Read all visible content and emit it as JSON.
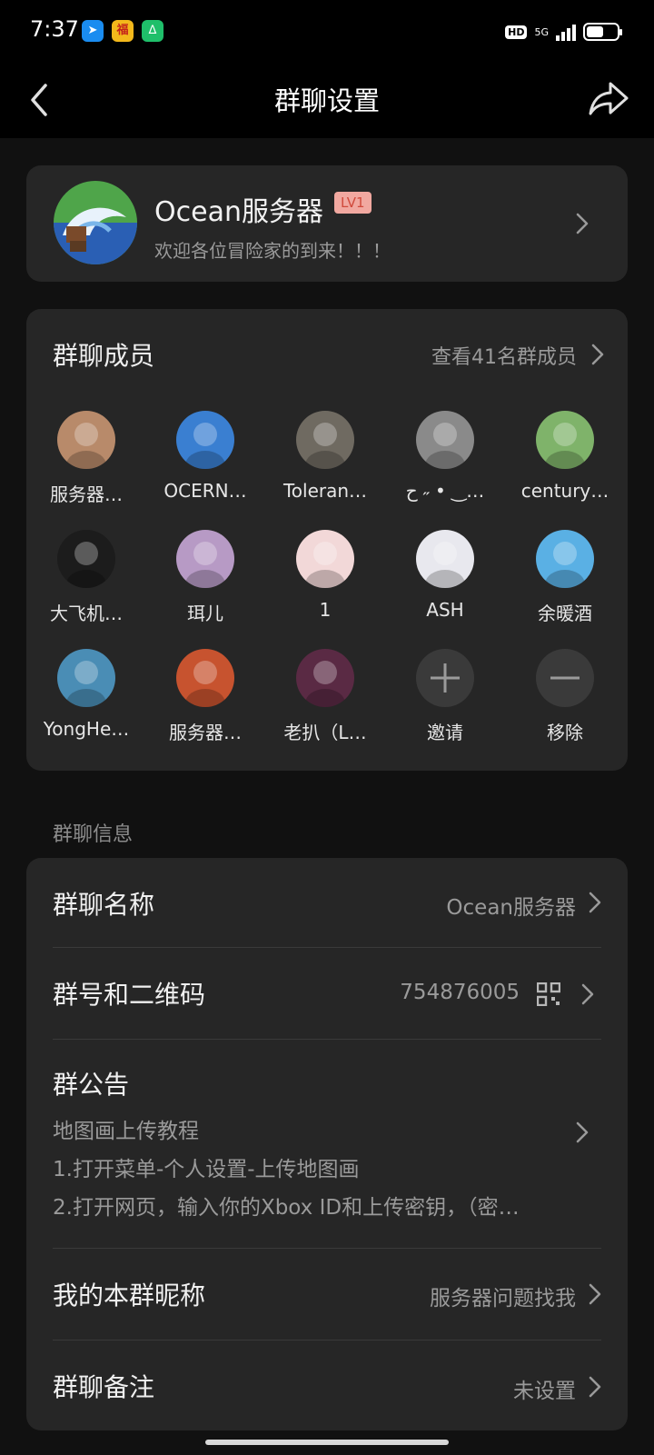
{
  "status_bar": {
    "time": "7:37",
    "apps": [
      "paper-plane-app-icon",
      "lottery-app-icon",
      "link-app-icon"
    ],
    "network": "5G",
    "hd": "HD",
    "battery_level": 0.55
  },
  "header": {
    "title": "群聊设置"
  },
  "group": {
    "name": "Ocean服务器",
    "level": "LV1",
    "description": "欢迎各位冒险家的到来！！！"
  },
  "members": {
    "title": "群聊成员",
    "view_all": "查看41名群成员",
    "list": [
      {
        "name": "服务器…",
        "color": "#b88a6a"
      },
      {
        "name": "OCERN…",
        "color": "#3a7fd1"
      },
      {
        "name": "Toleran…",
        "color": "#6f6a61"
      },
      {
        "name": "ح ˶ • ‿…",
        "color": "#8a8a8a"
      },
      {
        "name": "century…",
        "color": "#7fb36a"
      },
      {
        "name": "大飞机…",
        "color": "#1c1c1c"
      },
      {
        "name": "珥儿",
        "color": "#b79ac5"
      },
      {
        "name": "1",
        "color": "#f2d8d8"
      },
      {
        "name": "ASH",
        "color": "#e8e8ee"
      },
      {
        "name": "余暖酒",
        "color": "#5ab0e4"
      },
      {
        "name": "YongHe…",
        "color": "#4a8db5"
      },
      {
        "name": "服务器…",
        "color": "#c7532f"
      },
      {
        "name": "老扒（L…",
        "color": "#5a2a44"
      }
    ],
    "invite_label": "邀请",
    "remove_label": "移除"
  },
  "info": {
    "section_label": "群聊信息",
    "name_row": {
      "title": "群聊名称",
      "value": "Ocean服务器"
    },
    "number_row": {
      "title": "群号和二维码",
      "value": "754876005"
    },
    "notice_row": {
      "title": "群公告",
      "lines": [
        "地图画上传教程",
        "1.打开菜单-个人设置-上传地图画",
        "2.打开网页，输入你的Xbox ID和上传密钥，（密…"
      ]
    },
    "nickname_row": {
      "title": "我的本群昵称",
      "value": "服务器问题找我"
    },
    "remark_row": {
      "title": "群聊备注",
      "value": "未设置"
    }
  }
}
